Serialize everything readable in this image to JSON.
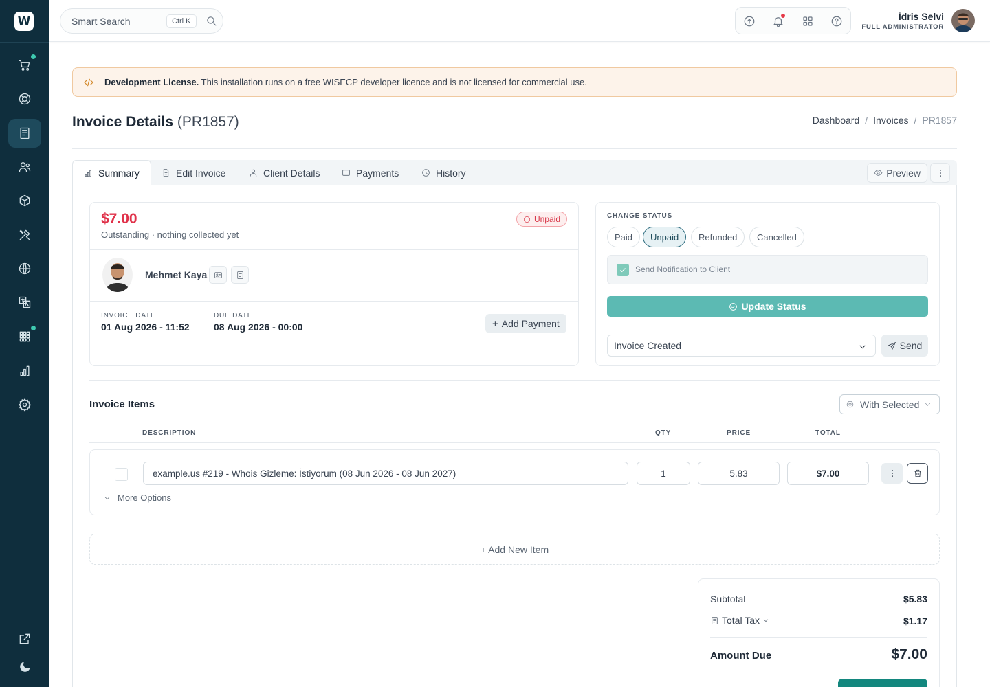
{
  "sidebar": {
    "logo_letter": "W",
    "items": [
      {
        "icon": "cart-icon",
        "dot": true
      },
      {
        "icon": "support-icon",
        "dot": false
      },
      {
        "icon": "invoice-icon",
        "active": true
      },
      {
        "icon": "users-icon"
      },
      {
        "icon": "box-icon"
      },
      {
        "icon": "tools-icon"
      },
      {
        "icon": "globe-icon"
      },
      {
        "icon": "translate-icon"
      },
      {
        "icon": "apps-icon",
        "dot": true
      },
      {
        "icon": "chart-icon"
      },
      {
        "icon": "gear-icon"
      }
    ],
    "bottom": [
      "external-link-icon",
      "moon-icon"
    ],
    "accent": "#3ec9b0"
  },
  "topbar": {
    "search_placeholder": "Smart Search",
    "shortcut": "Ctrl K",
    "user_name": "İdris Selvi",
    "user_role": "FULL ADMINISTRATOR"
  },
  "license": {
    "title": "Development License.",
    "text": " This installation runs on a free WISECP developer licence and is not licensed for commercial use."
  },
  "page": {
    "title": "Invoice Details",
    "invoice_id": "(PR1857)",
    "breadcrumb": [
      "Dashboard",
      "Invoices",
      "PR1857"
    ]
  },
  "tabs": [
    {
      "label": "Summary",
      "icon": "bar-chart-icon",
      "active": true
    },
    {
      "label": "Edit Invoice",
      "icon": "document-icon"
    },
    {
      "label": "Client Details",
      "icon": "user-icon"
    },
    {
      "label": "Payments",
      "icon": "credit-card-icon"
    },
    {
      "label": "History",
      "icon": "clock-icon"
    }
  ],
  "preview_label": "Preview",
  "summary": {
    "amount": "$7.00",
    "outstanding": "Outstanding · nothing collected yet",
    "status_badge": "Unpaid",
    "client_name": "Mehmet Kaya",
    "invoice_date_label": "INVOICE DATE",
    "invoice_date": "01 Aug 2026 - 11:52",
    "due_date_label": "DUE DATE",
    "due_date": "08 Aug 2026 - 00:00",
    "add_payment": "Add Payment"
  },
  "status": {
    "label": "CHANGE STATUS",
    "options": [
      "Paid",
      "Unpaid",
      "Refunded",
      "Cancelled"
    ],
    "selected": "Unpaid",
    "notify_label": "Send Notification to Client",
    "notify_checked": true,
    "update_label": "Update Status",
    "template_value": "Invoice Created",
    "send_label": "Send"
  },
  "items": {
    "title": "Invoice Items",
    "with_selected": "With Selected",
    "columns": [
      "DESCRIPTION",
      "QTY",
      "PRICE",
      "TOTAL"
    ],
    "rows": [
      {
        "description": "example.us #219 - Whois Gizleme: İstiyorum (08 Jun 2026 - 08 Jun 2027)",
        "qty": "1",
        "price": "5.83",
        "total": "$7.00"
      }
    ],
    "more_options": "More Options",
    "add_new": "+ Add New Item"
  },
  "totals": {
    "subtotal_label": "Subtotal",
    "subtotal": "$5.83",
    "tax_label": "Total Tax",
    "tax": "$1.17",
    "due_label": "Amount Due",
    "due": "$7.00"
  }
}
